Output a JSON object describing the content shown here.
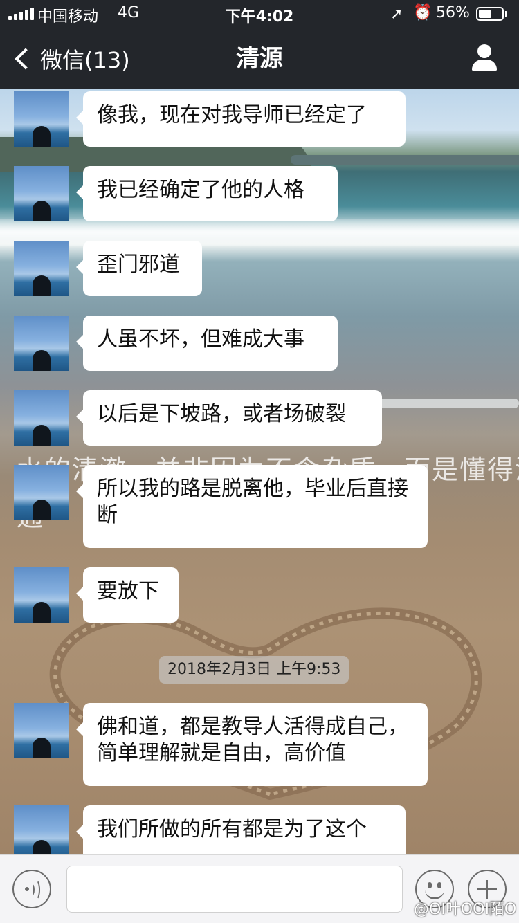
{
  "status_bar": {
    "carrier": "中国移动",
    "network": "4G",
    "time": "下午4:02",
    "battery_percent": "56%",
    "battery_level": 0.56,
    "location_icon": "location-arrow-icon",
    "alarm_icon": "alarm-icon"
  },
  "nav": {
    "back_label": "微信(13)",
    "title": "清源",
    "profile_icon": "person-icon"
  },
  "background_overlay_text": {
    "line1": "水的清澈，并非因为不含杂质，而是懂得沉淀；",
    "line2": "通　　　　　　　　　　　　　　　　　　　白取舍。"
  },
  "messages": [
    {
      "text": "像我，现在对我导师已经定了"
    },
    {
      "text": "我已经确定了他的人格"
    },
    {
      "text": "歪门邪道"
    },
    {
      "text": "人虽不坏，但难成大事"
    },
    {
      "text": "以后是下坡路，或者场破裂"
    },
    {
      "text": "所以我的路是脱离他，毕业后直接断"
    },
    {
      "text": "要放下"
    },
    {
      "text": "佛和道，都是教导人活得成自己，简单理解就是自由，高价值"
    },
    {
      "text": "我们所做的所有都是为了这个"
    }
  ],
  "timestamp": "2018年2月3日 上午9:53",
  "input_bar": {
    "voice_icon": "voice-icon",
    "input_value": "",
    "emoji_icon": "emoji-icon",
    "plus_icon": "plus-icon"
  },
  "watermark": "@OI叶OOI陌O",
  "colors": {
    "nav_background": "#23262b",
    "bubble_background": "#ffffff",
    "input_bar_background": "#f4f4f6"
  }
}
